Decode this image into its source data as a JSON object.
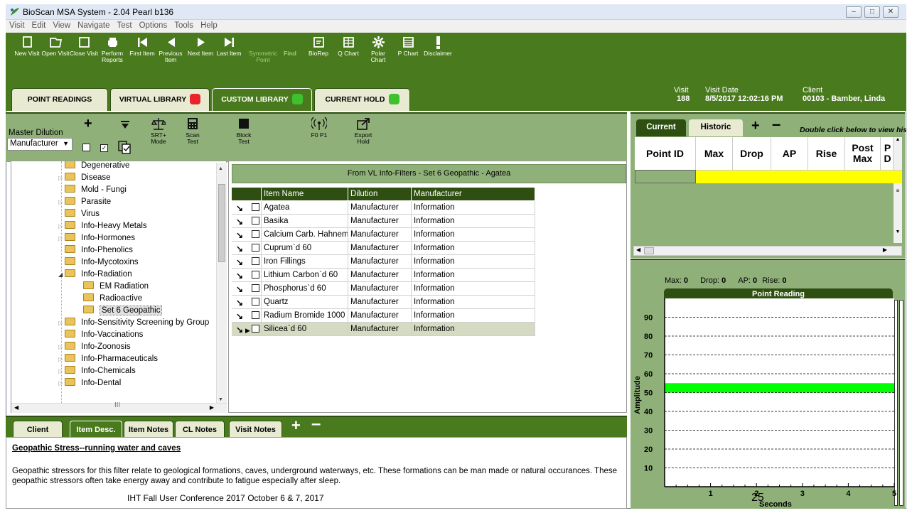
{
  "window": {
    "title": "BioScan MSA System - 2.04 Pearl b136",
    "controls": [
      "minimize",
      "maximize",
      "close"
    ]
  },
  "menu": [
    "Visit",
    "Edit",
    "View",
    "Navigate",
    "Test",
    "Options",
    "Tools",
    "Help"
  ],
  "toolbar": [
    {
      "label": "New Visit",
      "icon": "document-icon"
    },
    {
      "label": "Open Visit",
      "icon": "open-folder-icon"
    },
    {
      "label": "Close Visit",
      "icon": "close-document-icon"
    },
    {
      "label": "Perform Reports",
      "icon": "printer-icon"
    },
    {
      "label": "First Item",
      "icon": "first-icon"
    },
    {
      "label": "Previous Item",
      "icon": "previous-icon"
    },
    {
      "label": "Next Item",
      "icon": "next-icon"
    },
    {
      "label": "Last Item",
      "icon": "last-icon"
    },
    {
      "label": "Symmetric Point",
      "icon": "",
      "disabled": true
    },
    {
      "label": "Find",
      "icon": "",
      "disabled": true
    },
    {
      "label": "BioRep",
      "icon": "biorep-icon"
    },
    {
      "label": "Q Chart",
      "icon": "grid-icon"
    },
    {
      "label": "Polar Chart",
      "icon": "gear-icon"
    },
    {
      "label": "P Chart",
      "icon": "table-icon"
    },
    {
      "label": "Disclaimer",
      "icon": "exclamation-icon"
    }
  ],
  "main_tabs": [
    {
      "label": "POINT READINGS",
      "active": false
    },
    {
      "label": "VIRTUAL LIBRARY",
      "active": false,
      "badge_color": "#e8232a"
    },
    {
      "label": "CUSTOM LIBRARY",
      "active": true,
      "badge_color": "#3fc12e"
    },
    {
      "label": "CURRENT HOLD",
      "active": false,
      "badge_color": "#3fc12e"
    }
  ],
  "visit_info": {
    "visit_label": "Visit",
    "visit_value": "188",
    "date_label": "Visit Date",
    "date_value": "8/5/2017 12:02:16 PM",
    "client_label": "Client",
    "client_value": "00103 - Bamber, Linda"
  },
  "library_toolbar": {
    "master_dilution_label": "Master Dilution",
    "dilution_select": "Manufacturer",
    "srt_label": "SRT+ Mode",
    "scan_label": "Scan Test",
    "block_label": "Block Test",
    "f0p1_label": "F0 P1",
    "export_label": "Export Hold"
  },
  "tree": [
    {
      "label": "Degenerative",
      "level": 1,
      "expandable": false
    },
    {
      "label": "Disease",
      "level": 1,
      "expandable": true
    },
    {
      "label": "Mold - Fungi",
      "level": 1,
      "expandable": false
    },
    {
      "label": "Parasite",
      "level": 1,
      "expandable": true
    },
    {
      "label": "Virus",
      "level": 1,
      "expandable": false
    },
    {
      "label": "Info-Heavy Metals",
      "level": 1,
      "expandable": true
    },
    {
      "label": "Info-Hormones",
      "level": 1,
      "expandable": true
    },
    {
      "label": "Info-Phenolics",
      "level": 1,
      "expandable": false
    },
    {
      "label": "Info-Mycotoxins",
      "level": 1,
      "expandable": false
    },
    {
      "label": "Info-Radiation",
      "level": 1,
      "expandable": true,
      "expanded": true
    },
    {
      "label": "EM Radiation",
      "level": 2,
      "expandable": false
    },
    {
      "label": "Radioactive",
      "level": 2,
      "expandable": false
    },
    {
      "label": "Set 6 Geopathic",
      "level": 2,
      "expandable": false,
      "selected": true
    },
    {
      "label": "Info-Sensitivity Screening by Group",
      "level": 1,
      "expandable": true
    },
    {
      "label": "Info-Vaccinations",
      "level": 1,
      "expandable": false
    },
    {
      "label": "Info-Zoonosis",
      "level": 1,
      "expandable": true
    },
    {
      "label": "Info-Pharmaceuticals",
      "level": 1,
      "expandable": true
    },
    {
      "label": "Info-Chemicals",
      "level": 1,
      "expandable": true
    },
    {
      "label": "Info-Dental",
      "level": 1,
      "expandable": true
    }
  ],
  "items_panel": {
    "header": "From VL Info-Filters - Set 6 Geopathic - Agatea",
    "columns": [
      "Item Name",
      "Dilution",
      "Manufacturer"
    ],
    "rows": [
      [
        "Agatea",
        "Manufacturer",
        "Information"
      ],
      [
        "Basika",
        "Manufacturer",
        "Information"
      ],
      [
        "Calcium Carb. Hahnem",
        "Manufacturer",
        "Information"
      ],
      [
        "Cuprum`d 60",
        "Manufacturer",
        "Information"
      ],
      [
        "Iron Fillings",
        "Manufacturer",
        "Information"
      ],
      [
        "Lithium Carbon`d 60",
        "Manufacturer",
        "Information"
      ],
      [
        "Phosphorus`d 60",
        "Manufacturer",
        "Information"
      ],
      [
        "Quartz",
        "Manufacturer",
        "Information"
      ],
      [
        "Radium Bromide 1000",
        "Manufacturer",
        "Information"
      ],
      [
        "Silicea`d 60",
        "Manufacturer",
        "Information"
      ]
    ],
    "selected_row": 9
  },
  "notes": {
    "tabs": [
      "Client",
      "Item Desc.",
      "Item Notes",
      "CL Notes",
      "Visit Notes"
    ],
    "active_tab": "Item Desc.",
    "title": "Geopathic Stress--running water and caves",
    "body": "Geopathic stressors for this filter relate to geological formations, caves, underground waterways, etc. These formations can be man made or natural occurances. These geopathic stressors often take energy away and contribute to fatigue especially after sleep.",
    "footer": "IHT Fall User Conference 2017   October 6 & 7, 2017"
  },
  "readings_panel": {
    "tabs": [
      "Current",
      "Historic"
    ],
    "hint": "Double click below to view his",
    "columns": [
      "Point ID",
      "Max",
      "Drop",
      "AP",
      "Rise",
      "Post Max",
      "P D"
    ]
  },
  "chart_data": {
    "type": "line",
    "title": "Point Reading",
    "stats": {
      "max_label": "Max:",
      "max": "0",
      "drop_label": "Drop:",
      "drop": "0",
      "ap_label": "AP:",
      "ap": "0",
      "rise_label": "Rise:",
      "rise": "0"
    },
    "ylabel": "Amplitude",
    "xlabel": "Seconds",
    "yticks": [
      10,
      20,
      30,
      40,
      50,
      60,
      70,
      80,
      90
    ],
    "xticks": [
      1,
      2,
      3,
      4,
      5
    ],
    "ylim": [
      0,
      100
    ],
    "xlim": [
      0,
      5
    ],
    "grid": "horizontal dashed",
    "band": {
      "from": 50,
      "to": 55,
      "color": "#00ff00"
    },
    "series": []
  },
  "page_number": "25"
}
